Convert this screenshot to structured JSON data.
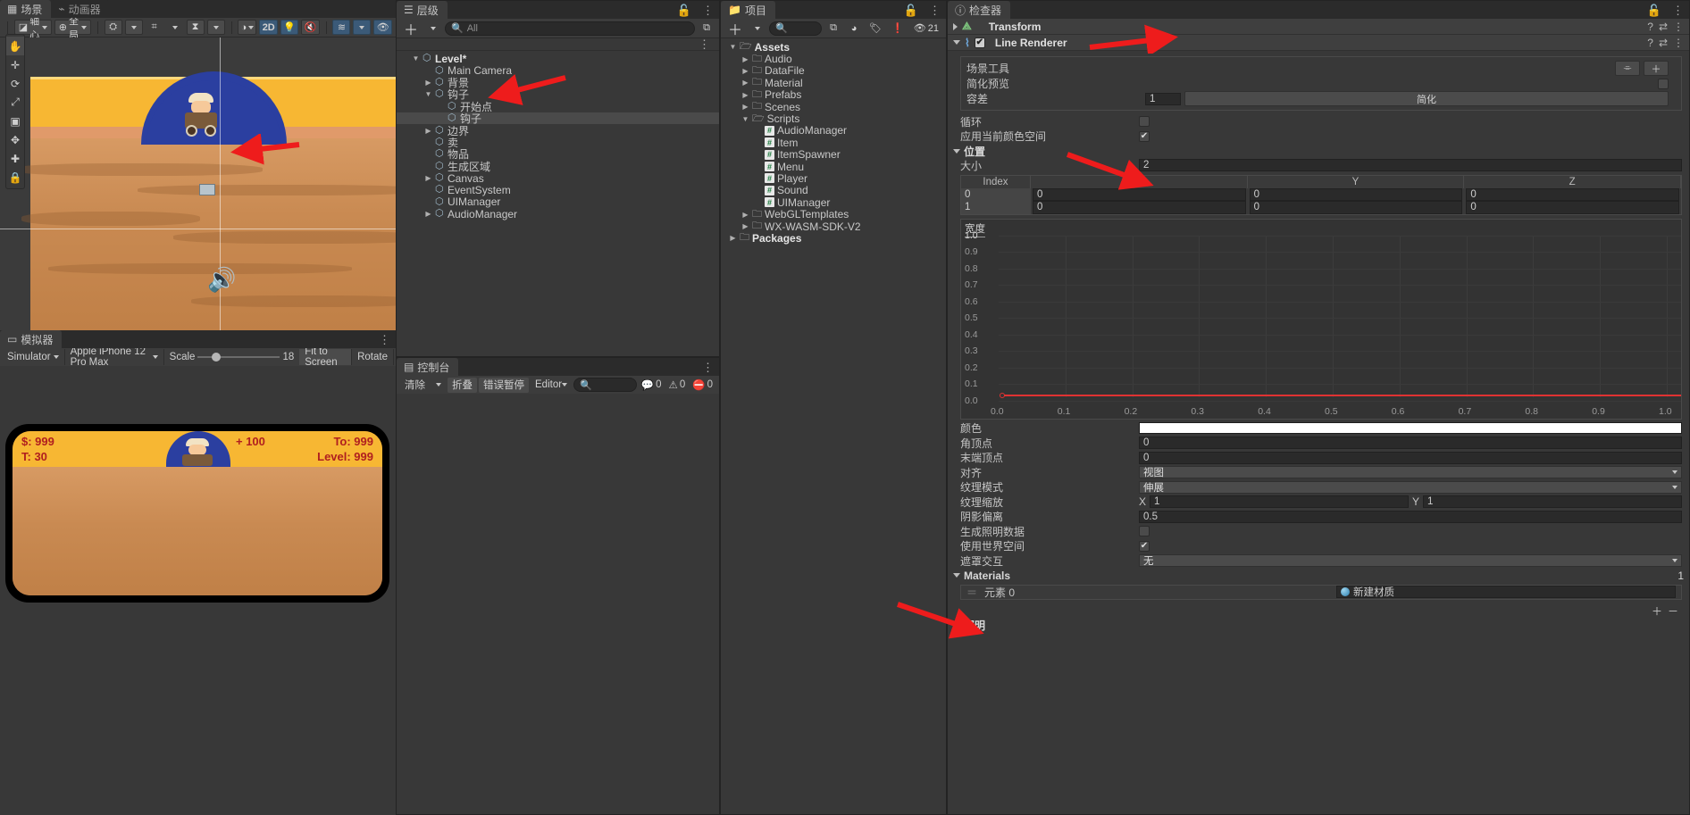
{
  "scene": {
    "tab_active": "场景",
    "tab_inactive": "动画器",
    "toolbar": {
      "pivot": "轴心",
      "global": "全局",
      "handles_icon": "handles-icon",
      "grid_icon": "grid-snap-icon",
      "ruler_icon": "ruler-icon",
      "shading_icon": "shading-icon",
      "mode2d": "2D",
      "light_icon": "light-icon",
      "audio_icon": "audio-mute-icon"
    },
    "left_tools": [
      "hand-tool",
      "move-tool",
      "rotate-tool",
      "scale-tool",
      "rect-tool",
      "transform-tool",
      "plus-tool",
      "lock-tool"
    ]
  },
  "simulator": {
    "tab": "模拟器",
    "mode": "Simulator",
    "device": "Apple iPhone 12 Pro Max",
    "scale_label": "Scale",
    "scale_value": "18",
    "fit": "Fit to Screen",
    "rotate": "Rotate",
    "game_hud": {
      "money": "$: 999",
      "time": "T: 30",
      "bonus": "+ 100",
      "target": "To: 999",
      "level": "Level: 999"
    }
  },
  "hierarchy": {
    "tab": "层级",
    "search_placeholder": "All",
    "rows": [
      {
        "label": "Level*",
        "depth": 0,
        "arrow": "down",
        "icon": "scene-icon",
        "bold": true,
        "selected": false
      },
      {
        "label": "Main Camera",
        "depth": 1,
        "arrow": "none",
        "icon": "cube-icon",
        "bold": false,
        "selected": false
      },
      {
        "label": "背景",
        "depth": 1,
        "arrow": "right",
        "icon": "cube-icon",
        "bold": false,
        "selected": false
      },
      {
        "label": "钩子",
        "depth": 1,
        "arrow": "down",
        "icon": "cube-icon",
        "bold": false,
        "selected": false
      },
      {
        "label": "开始点",
        "depth": 2,
        "arrow": "none",
        "icon": "cube-icon",
        "bold": false,
        "selected": false
      },
      {
        "label": "钩子",
        "depth": 2,
        "arrow": "none",
        "icon": "cube-icon",
        "bold": false,
        "selected": true
      },
      {
        "label": "边界",
        "depth": 1,
        "arrow": "right",
        "icon": "cube-icon",
        "bold": false,
        "selected": false
      },
      {
        "label": "卖",
        "depth": 1,
        "arrow": "none",
        "icon": "cube-icon",
        "bold": false,
        "selected": false
      },
      {
        "label": "物品",
        "depth": 1,
        "arrow": "none",
        "icon": "cube-icon",
        "bold": false,
        "selected": false
      },
      {
        "label": "生成区域",
        "depth": 1,
        "arrow": "none",
        "icon": "cube-icon",
        "bold": false,
        "selected": false
      },
      {
        "label": "Canvas",
        "depth": 1,
        "arrow": "right",
        "icon": "cube-icon",
        "bold": false,
        "selected": false
      },
      {
        "label": "EventSystem",
        "depth": 1,
        "arrow": "none",
        "icon": "cube-icon",
        "bold": false,
        "selected": false
      },
      {
        "label": "UIManager",
        "depth": 1,
        "arrow": "none",
        "icon": "cube-icon",
        "bold": false,
        "selected": false
      },
      {
        "label": "AudioManager",
        "depth": 1,
        "arrow": "right",
        "icon": "cube-icon",
        "bold": false,
        "selected": false
      }
    ]
  },
  "console": {
    "tab": "控制台",
    "clear": "清除",
    "collapse": "折叠",
    "error_pause": "错误暂停",
    "editor": "Editor",
    "counts": {
      "log": "0",
      "warn": "0",
      "error": "0"
    }
  },
  "project": {
    "tab": "项目",
    "badge_count": "21",
    "rows": [
      {
        "label": "Assets",
        "depth": 0,
        "arrow": "down",
        "icon": "folder-open-icon",
        "bold": true
      },
      {
        "label": "Audio",
        "depth": 1,
        "arrow": "right",
        "icon": "folder-icon",
        "bold": false
      },
      {
        "label": "DataFile",
        "depth": 1,
        "arrow": "right",
        "icon": "folder-icon",
        "bold": false
      },
      {
        "label": "Material",
        "depth": 1,
        "arrow": "right",
        "icon": "folder-icon",
        "bold": false
      },
      {
        "label": "Prefabs",
        "depth": 1,
        "arrow": "right",
        "icon": "folder-icon",
        "bold": false
      },
      {
        "label": "Scenes",
        "depth": 1,
        "arrow": "right",
        "icon": "folder-icon",
        "bold": false
      },
      {
        "label": "Scripts",
        "depth": 1,
        "arrow": "down",
        "icon": "folder-open-icon",
        "bold": false
      },
      {
        "label": "AudioManager",
        "depth": 2,
        "arrow": "none",
        "icon": "cs-script-icon",
        "bold": false
      },
      {
        "label": "Item",
        "depth": 2,
        "arrow": "none",
        "icon": "cs-script-icon",
        "bold": false
      },
      {
        "label": "ItemSpawner",
        "depth": 2,
        "arrow": "none",
        "icon": "cs-script-icon",
        "bold": false
      },
      {
        "label": "Menu",
        "depth": 2,
        "arrow": "none",
        "icon": "cs-script-icon",
        "bold": false
      },
      {
        "label": "Player",
        "depth": 2,
        "arrow": "none",
        "icon": "cs-script-icon",
        "bold": false
      },
      {
        "label": "Sound",
        "depth": 2,
        "arrow": "none",
        "icon": "cs-script-icon",
        "bold": false
      },
      {
        "label": "UIManager",
        "depth": 2,
        "arrow": "none",
        "icon": "cs-script-icon",
        "bold": false
      },
      {
        "label": "WebGLTemplates",
        "depth": 1,
        "arrow": "right",
        "icon": "folder-icon",
        "bold": false
      },
      {
        "label": "WX-WASM-SDK-V2",
        "depth": 1,
        "arrow": "right",
        "icon": "folder-icon",
        "bold": false
      },
      {
        "label": "Packages",
        "depth": 0,
        "arrow": "right",
        "icon": "folder-icon",
        "bold": true
      }
    ]
  },
  "inspector": {
    "tab": "检查器",
    "transform": {
      "name": "Transform"
    },
    "line_renderer": {
      "name": "Line Renderer",
      "enabled": true,
      "scene_tools_label": "场景工具",
      "simplify_preview_label": "简化预览",
      "tolerance_label": "容差",
      "tolerance_value": "1",
      "simplify_button": "简化",
      "loop_label": "循环",
      "loop_checked": false,
      "color_space_label": "应用当前颜色空间",
      "color_space_checked": true,
      "positions_label": "位置",
      "size_label": "大小",
      "size_value": "2",
      "table_headers": [
        "Index",
        "X",
        "Y",
        "Z"
      ],
      "table_rows": [
        {
          "index": "0",
          "x": "0",
          "y": "0",
          "z": "0"
        },
        {
          "index": "1",
          "x": "0",
          "y": "0",
          "z": "0"
        }
      ],
      "width_title": "宽度",
      "width_y_ticks": [
        "1.0",
        "0.9",
        "0.8",
        "0.7",
        "0.6",
        "0.5",
        "0.4",
        "0.3",
        "0.2",
        "0.1",
        "0.0"
      ],
      "width_x_ticks": [
        "0.0",
        "0.1",
        "0.2",
        "0.3",
        "0.4",
        "0.5",
        "0.6",
        "0.7",
        "0.8",
        "0.9",
        "1.0"
      ],
      "props": [
        {
          "label": "颜色",
          "type": "color",
          "value": "#ffffff"
        },
        {
          "label": "角顶点",
          "type": "field",
          "value": "0"
        },
        {
          "label": "末端顶点",
          "type": "field",
          "value": "0"
        },
        {
          "label": "对齐",
          "type": "dropdown",
          "value": "视图"
        },
        {
          "label": "纹理模式",
          "type": "dropdown",
          "value": "伸展"
        },
        {
          "label": "纹理缩放",
          "type": "vec2",
          "x_label": "X",
          "x": "1",
          "y_label": "Y",
          "y": "1"
        },
        {
          "label": "阴影偏离",
          "type": "field",
          "value": "0.5"
        },
        {
          "label": "生成照明数据",
          "type": "checkbox",
          "checked": false
        },
        {
          "label": "使用世界空间",
          "type": "checkbox",
          "checked": true
        },
        {
          "label": "遮罩交互",
          "type": "dropdown",
          "value": "无"
        }
      ],
      "materials_label": "Materials",
      "materials_count": "1",
      "material_element_label": "元素 0",
      "material_value": "新建材质",
      "lighting_label": "照明"
    }
  },
  "chart_data": {
    "type": "line",
    "title": "宽度",
    "x": [
      0.0,
      1.0
    ],
    "values": [
      0.0,
      0.0
    ],
    "xlabel": "",
    "ylabel": "",
    "xlim": [
      0.0,
      1.0
    ],
    "ylim": [
      0.0,
      1.0
    ],
    "xticks": [
      0.0,
      0.1,
      0.2,
      0.3,
      0.4,
      0.5,
      0.6,
      0.7,
      0.8,
      0.9,
      1.0
    ],
    "yticks": [
      0.0,
      0.1,
      0.2,
      0.3,
      0.4,
      0.5,
      0.6,
      0.7,
      0.8,
      0.9,
      1.0
    ],
    "series_color": "#e03232",
    "grid": true,
    "legend": "none"
  },
  "annotations": {
    "arrow_color": "#ee1c1c",
    "arrows": [
      "scene-hook-arrow",
      "hierarchy-hook-arrow",
      "line-renderer-arrow",
      "positions-arrow",
      "materials-arrow"
    ]
  }
}
